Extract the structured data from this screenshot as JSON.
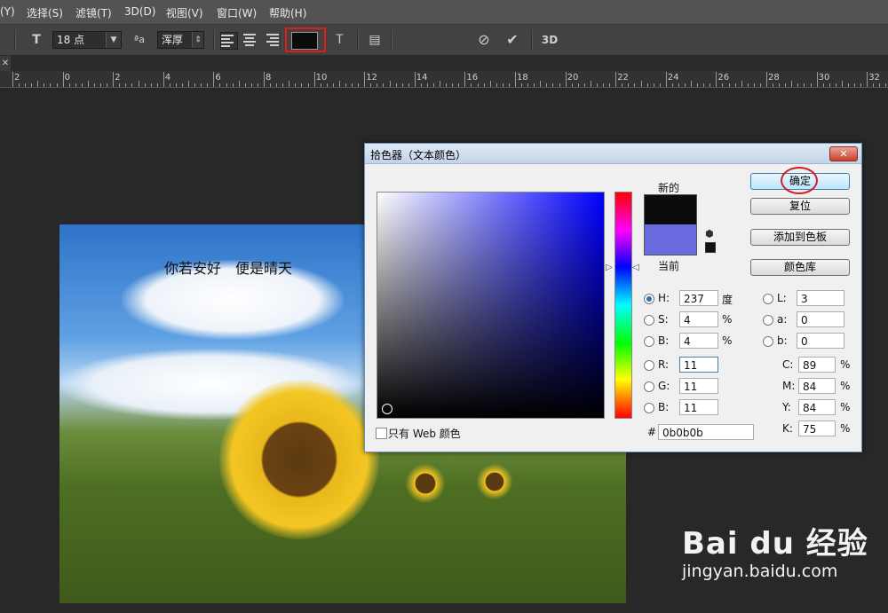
{
  "menu": [
    "(Y)",
    "选择(S)",
    "滤镜(T)",
    "3D(D)",
    "视图(V)",
    "窗口(W)",
    "帮助(H)"
  ],
  "options": {
    "font_size": "18 点",
    "aa_glyph": "ªa",
    "antialias": "浑厚",
    "label_3d": "3D",
    "text_color": "#0b0b0b"
  },
  "ruler": [
    "2",
    "0",
    "2",
    "4",
    "6",
    "8",
    "10",
    "12",
    "14",
    "16",
    "18",
    "20",
    "22",
    "24",
    "26",
    "28",
    "30",
    "32"
  ],
  "canvas": {
    "text": "你若安好　便是晴天"
  },
  "dialog": {
    "title": "拾色器（文本颜色）",
    "new_label": "新的",
    "current_label": "当前",
    "new_color": "#0b0b0b",
    "current_color": "#6b6be0",
    "buttons": {
      "ok": "确定",
      "reset": "复位",
      "add_swatch": "添加到色板",
      "library": "颜色库"
    },
    "hsb": [
      {
        "label": "H:",
        "value": "237",
        "unit": "度"
      },
      {
        "label": "S:",
        "value": "4",
        "unit": "%"
      },
      {
        "label": "B:",
        "value": "4",
        "unit": "%"
      }
    ],
    "rgb": [
      {
        "label": "R:",
        "value": "11"
      },
      {
        "label": "G:",
        "value": "11"
      },
      {
        "label": "B:",
        "value": "11"
      }
    ],
    "lab": [
      {
        "label": "L:",
        "value": "3"
      },
      {
        "label": "a:",
        "value": "0"
      },
      {
        "label": "b:",
        "value": "0"
      }
    ],
    "cmyk": [
      {
        "label": "C:",
        "value": "89",
        "unit": "%"
      },
      {
        "label": "M:",
        "value": "84",
        "unit": "%"
      },
      {
        "label": "Y:",
        "value": "84",
        "unit": "%"
      },
      {
        "label": "K:",
        "value": "75",
        "unit": "%"
      }
    ],
    "web_only": "只有 Web 颜色",
    "hex_label": "#",
    "hex": "0b0b0b"
  },
  "watermark": {
    "logo": "Bai du 经验",
    "url": "jingyan.baidu.com"
  }
}
